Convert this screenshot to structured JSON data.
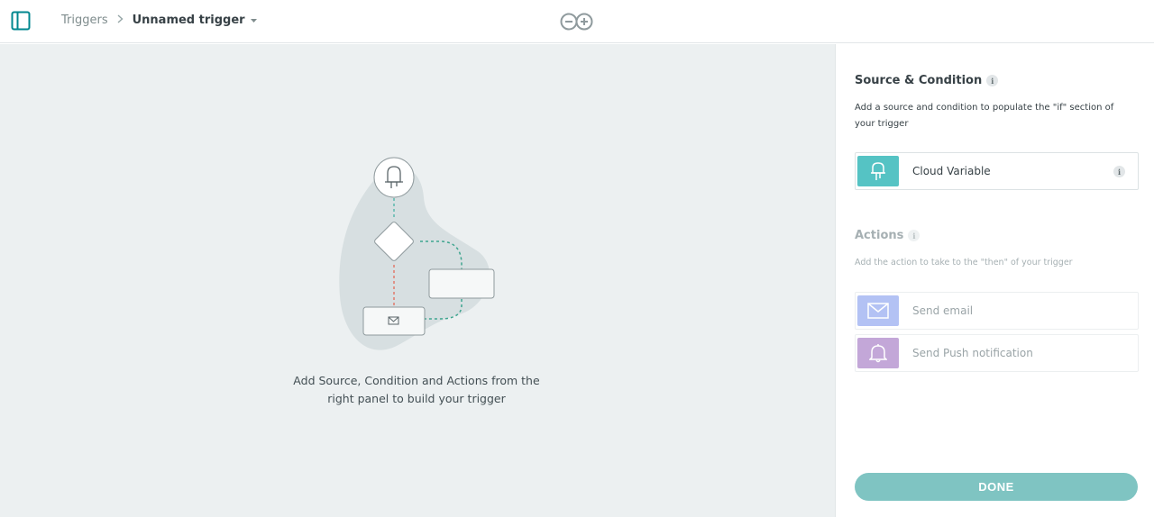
{
  "header": {
    "breadcrumb_root": "Triggers",
    "trigger_name": "Unnamed trigger"
  },
  "canvas": {
    "hint": "Add Source, Condition and Actions from the right panel to build your trigger"
  },
  "source_section": {
    "title": "Source & Condition",
    "description": "Add a source and condition to populate the \"if\" section of your trigger",
    "items": [
      {
        "label": "Cloud Variable",
        "icon": "led-icon",
        "color": "#55c3c4"
      }
    ]
  },
  "actions_section": {
    "title": "Actions",
    "description": "Add the action to take to the \"then\" of your trigger",
    "items": [
      {
        "label": "Send email",
        "icon": "envelope-icon",
        "color": "#b3c2f4"
      },
      {
        "label": "Send Push notification",
        "icon": "bell-icon",
        "color": "#c3a7d8"
      }
    ]
  },
  "done_label": "DONE",
  "colors": {
    "accent": "#00878f",
    "done_button": "#7fc4c2",
    "canvas_bg": "#ecf0f1"
  }
}
